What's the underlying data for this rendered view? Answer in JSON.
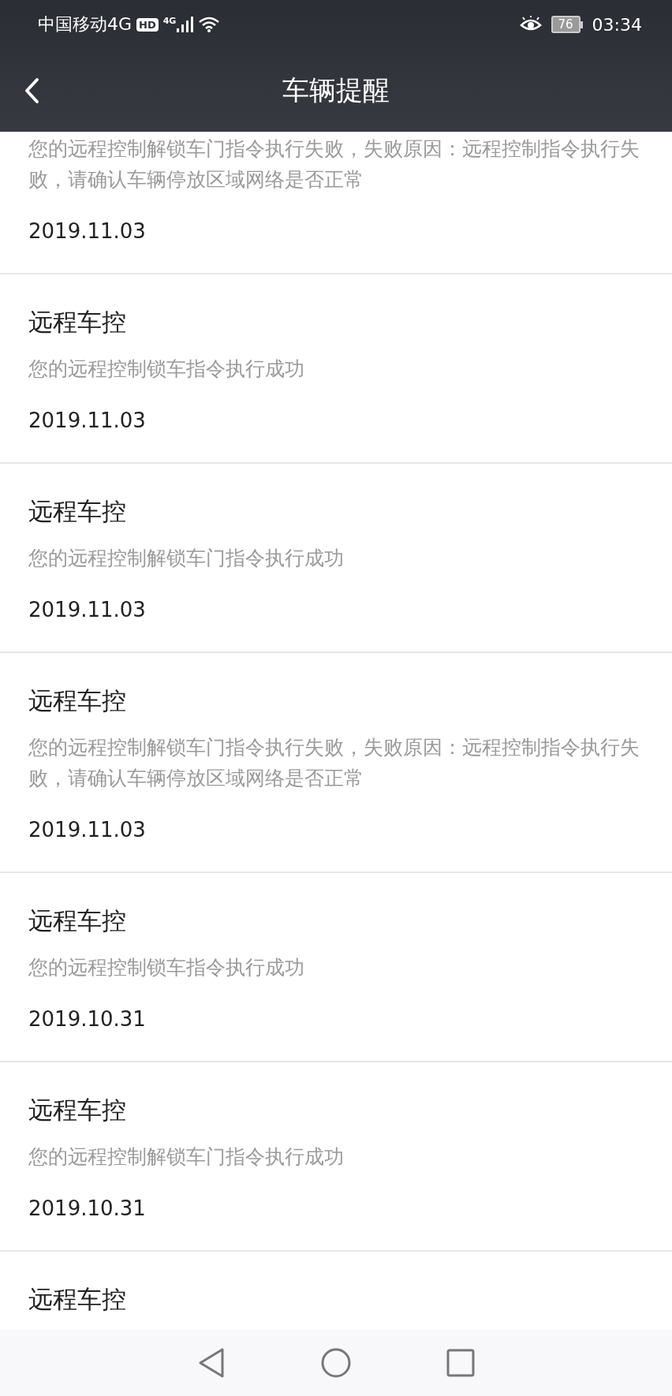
{
  "status_bar": {
    "carrier": "中国移动4G",
    "hd_badge": "HD",
    "network_label": "4G",
    "battery": "76",
    "time": "03:34"
  },
  "header": {
    "title": "车辆提醒"
  },
  "messages": [
    {
      "message": "您的远程控制解锁车门指令执行失败，失败原因：远程控制指令执行失败，请确认车辆停放区域网络是否正常",
      "date": "2019.11.03"
    },
    {
      "title": "远程车控",
      "message": "您的远程控制锁车指令执行成功",
      "date": "2019.11.03"
    },
    {
      "title": "远程车控",
      "message": "您的远程控制解锁车门指令执行成功",
      "date": "2019.11.03"
    },
    {
      "title": "远程车控",
      "message": "您的远程控制解锁车门指令执行失败，失败原因：远程控制指令执行失败，请确认车辆停放区域网络是否正常",
      "date": "2019.11.03"
    },
    {
      "title": "远程车控",
      "message": "您的远程控制锁车指令执行成功",
      "date": "2019.10.31"
    },
    {
      "title": "远程车控",
      "message": "您的远程控制解锁车门指令执行成功",
      "date": "2019.10.31"
    },
    {
      "title": "远程车控"
    }
  ]
}
